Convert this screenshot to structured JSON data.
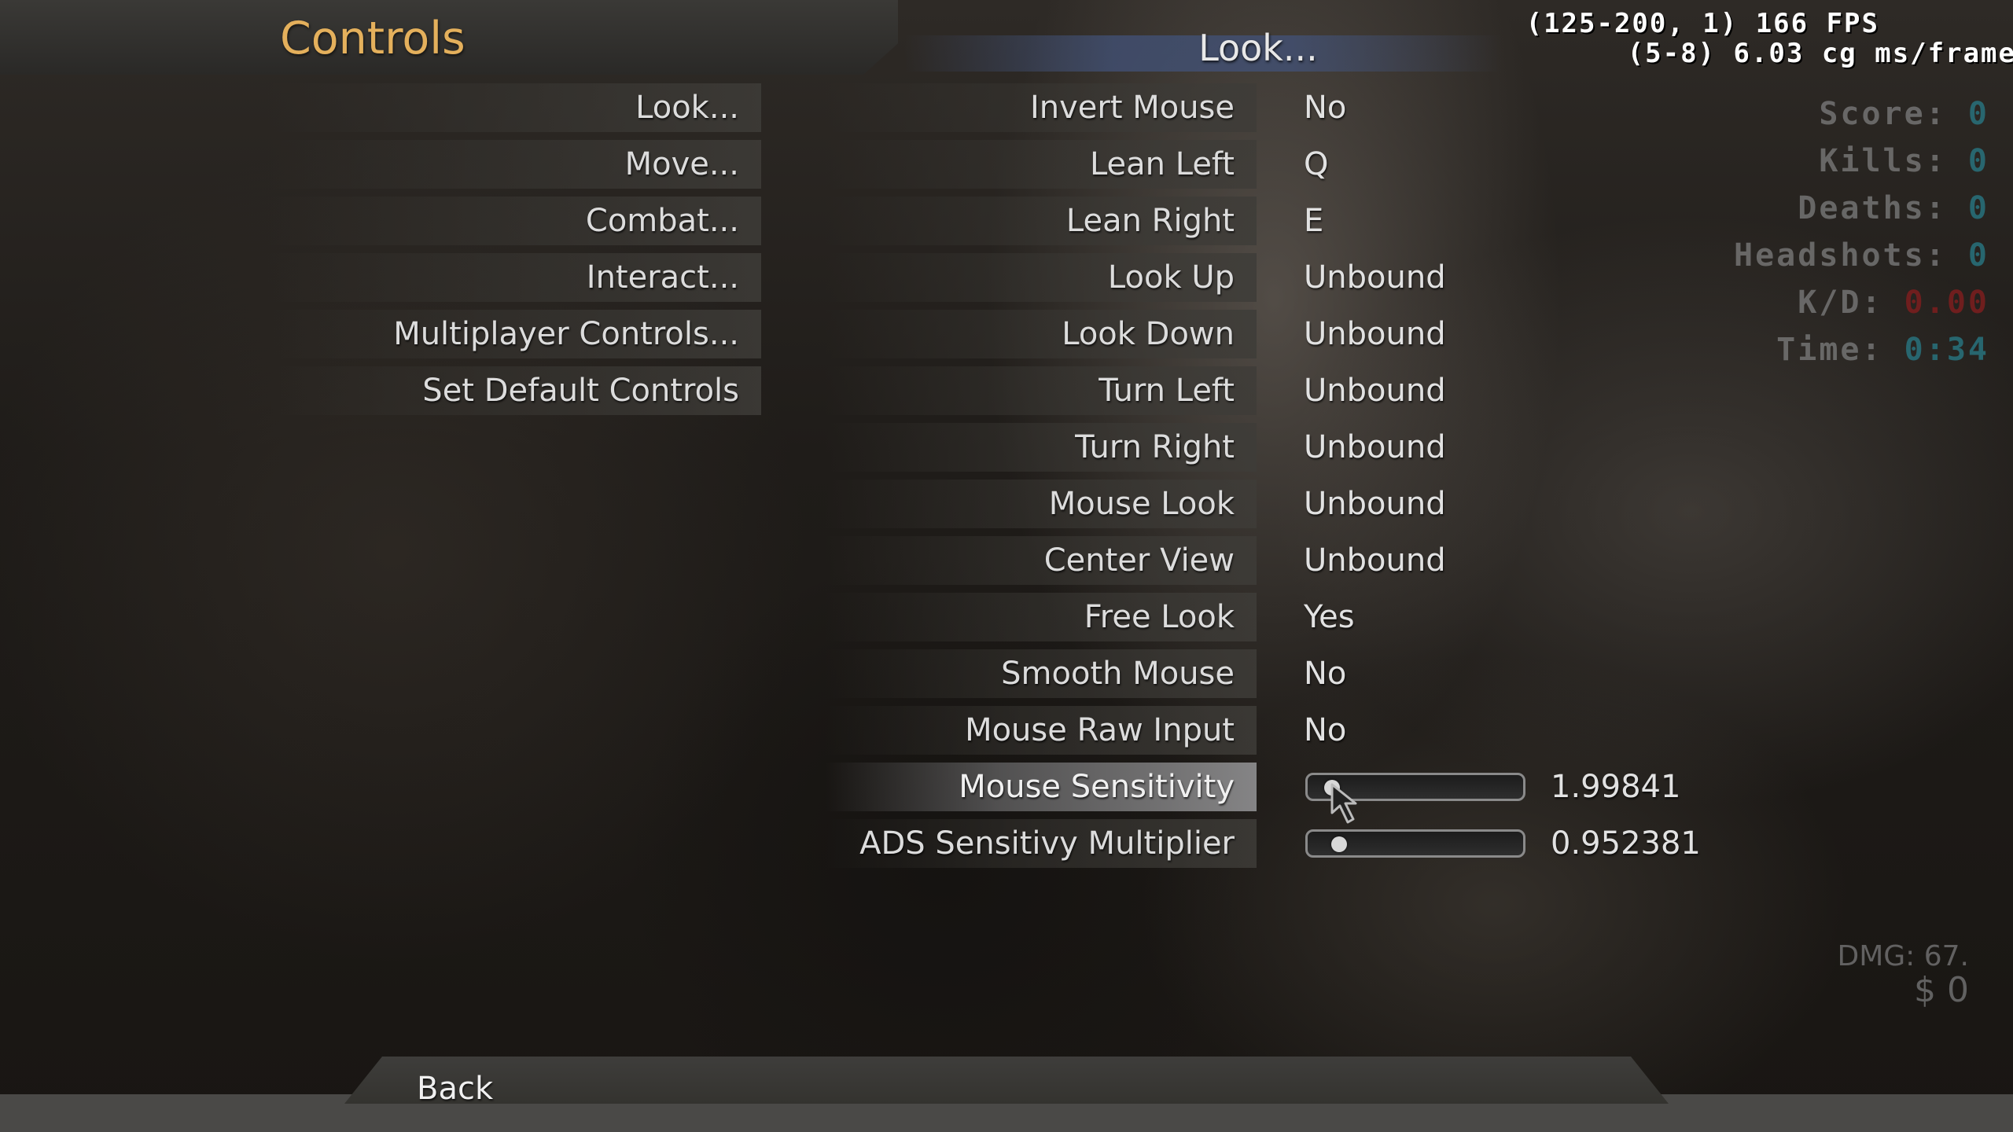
{
  "header": {
    "title": "Controls",
    "section_title": "Look..."
  },
  "categories": [
    {
      "label": "Look..."
    },
    {
      "label": "Move..."
    },
    {
      "label": "Combat..."
    },
    {
      "label": "Interact..."
    },
    {
      "label": "Multiplayer Controls..."
    },
    {
      "label": "Set Default Controls"
    }
  ],
  "settings": [
    {
      "label": "Invert Mouse",
      "value": "No"
    },
    {
      "label": "Lean Left",
      "value": "Q"
    },
    {
      "label": "Lean Right",
      "value": "E"
    },
    {
      "label": "Look Up",
      "value": "Unbound"
    },
    {
      "label": "Look Down",
      "value": "Unbound"
    },
    {
      "label": "Turn Left",
      "value": "Unbound"
    },
    {
      "label": "Turn Right",
      "value": "Unbound"
    },
    {
      "label": "Mouse Look",
      "value": "Unbound"
    },
    {
      "label": "Center View",
      "value": "Unbound"
    },
    {
      "label": "Free Look",
      "value": "Yes"
    },
    {
      "label": "Smooth Mouse",
      "value": "No"
    },
    {
      "label": "Mouse Raw Input",
      "value": "No"
    }
  ],
  "sliders": [
    {
      "label": "Mouse Sensitivity",
      "value": "1.99841",
      "fraction": 0.06,
      "selected": true
    },
    {
      "label": "ADS Sensitivy Multiplier",
      "value": "0.952381",
      "fraction": 0.1,
      "selected": false
    }
  ],
  "fps_overlay": {
    "line1": "(125-200, 1) 166 FPS",
    "line2": "(5-8) 6.03 cg ms/frame"
  },
  "stats": {
    "score_label": "Score:",
    "score_value": "0",
    "kills_label": "Kills:",
    "kills_value": "0",
    "deaths_label": "Deaths:",
    "deaths_value": "0",
    "headshots_label": "Headshots:",
    "headshots_value": "0",
    "kd_label": "K/D:",
    "kd_value": "0.00",
    "time_label": "Time:",
    "time_value": "0:34"
  },
  "hud": {
    "dmg": "DMG: 67.",
    "money": "$ 0"
  },
  "footer": {
    "back_label": "Back"
  },
  "colors": {
    "title": "#e4b05c",
    "stat_value": "#286e78",
    "stat_value_bad": "#781e1e"
  }
}
